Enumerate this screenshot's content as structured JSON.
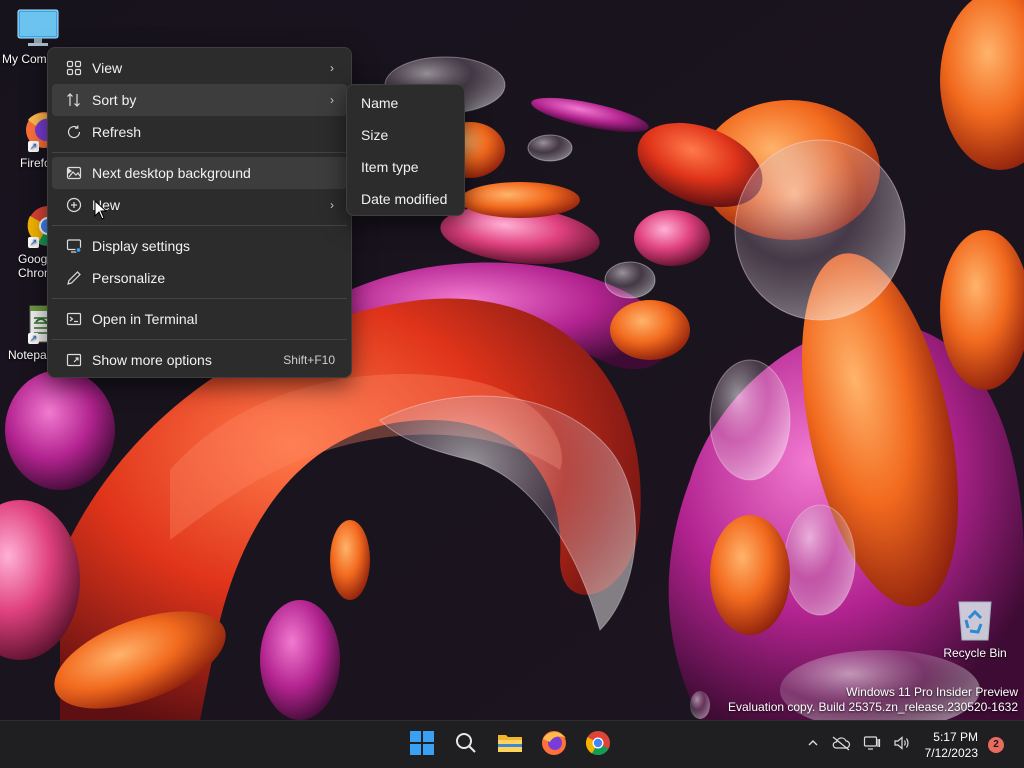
{
  "desktop": {
    "icons": [
      {
        "label": "My Com",
        "icon": "monitor-icon"
      },
      {
        "label": "Firefo",
        "icon": "firefox-icon"
      },
      {
        "label": "Goog",
        "label2": "Chrom",
        "icon": "chrome-icon"
      },
      {
        "label": "Notepa",
        "icon": "notepad-icon"
      }
    ],
    "recycle_bin": {
      "label": "Recycle Bin",
      "icon": "recycle-bin-icon"
    }
  },
  "context_menu": {
    "items": [
      {
        "label": "View",
        "icon": "view-grid-icon",
        "submenu": true
      },
      {
        "label": "Sort by",
        "icon": "sort-icon",
        "submenu": true
      },
      {
        "label": "Refresh",
        "icon": "refresh-icon"
      },
      {
        "label": "Next desktop background",
        "icon": "next-background-icon"
      },
      {
        "label": "New",
        "icon": "new-plus-icon",
        "submenu": true
      },
      {
        "label": "Display settings",
        "icon": "display-settings-icon"
      },
      {
        "label": "Personalize",
        "icon": "personalize-pen-icon"
      },
      {
        "label": "Open in Terminal",
        "icon": "terminal-icon"
      },
      {
        "label": "Show more options",
        "icon": "more-options-icon",
        "accelerator": "Shift+F10"
      }
    ]
  },
  "sort_submenu": {
    "items": [
      "Name",
      "Size",
      "Item type",
      "Date modified"
    ]
  },
  "watermark": {
    "line1": "Windows 11 Pro Insider Preview",
    "line2": "Evaluation copy. Build 25375.zn_release.230520-1632"
  },
  "taskbar": {
    "apps": [
      "start-icon",
      "search-icon",
      "file-explorer-icon",
      "firefox-icon",
      "chrome-icon"
    ],
    "clock": {
      "time": "5:17 PM",
      "date": "7/12/2023"
    },
    "notifications": "2"
  },
  "colors": {
    "menu_bg": "#2c2c2c",
    "taskbar_bg": "#1f1f22",
    "accent_blue": "#3aa0f3"
  }
}
